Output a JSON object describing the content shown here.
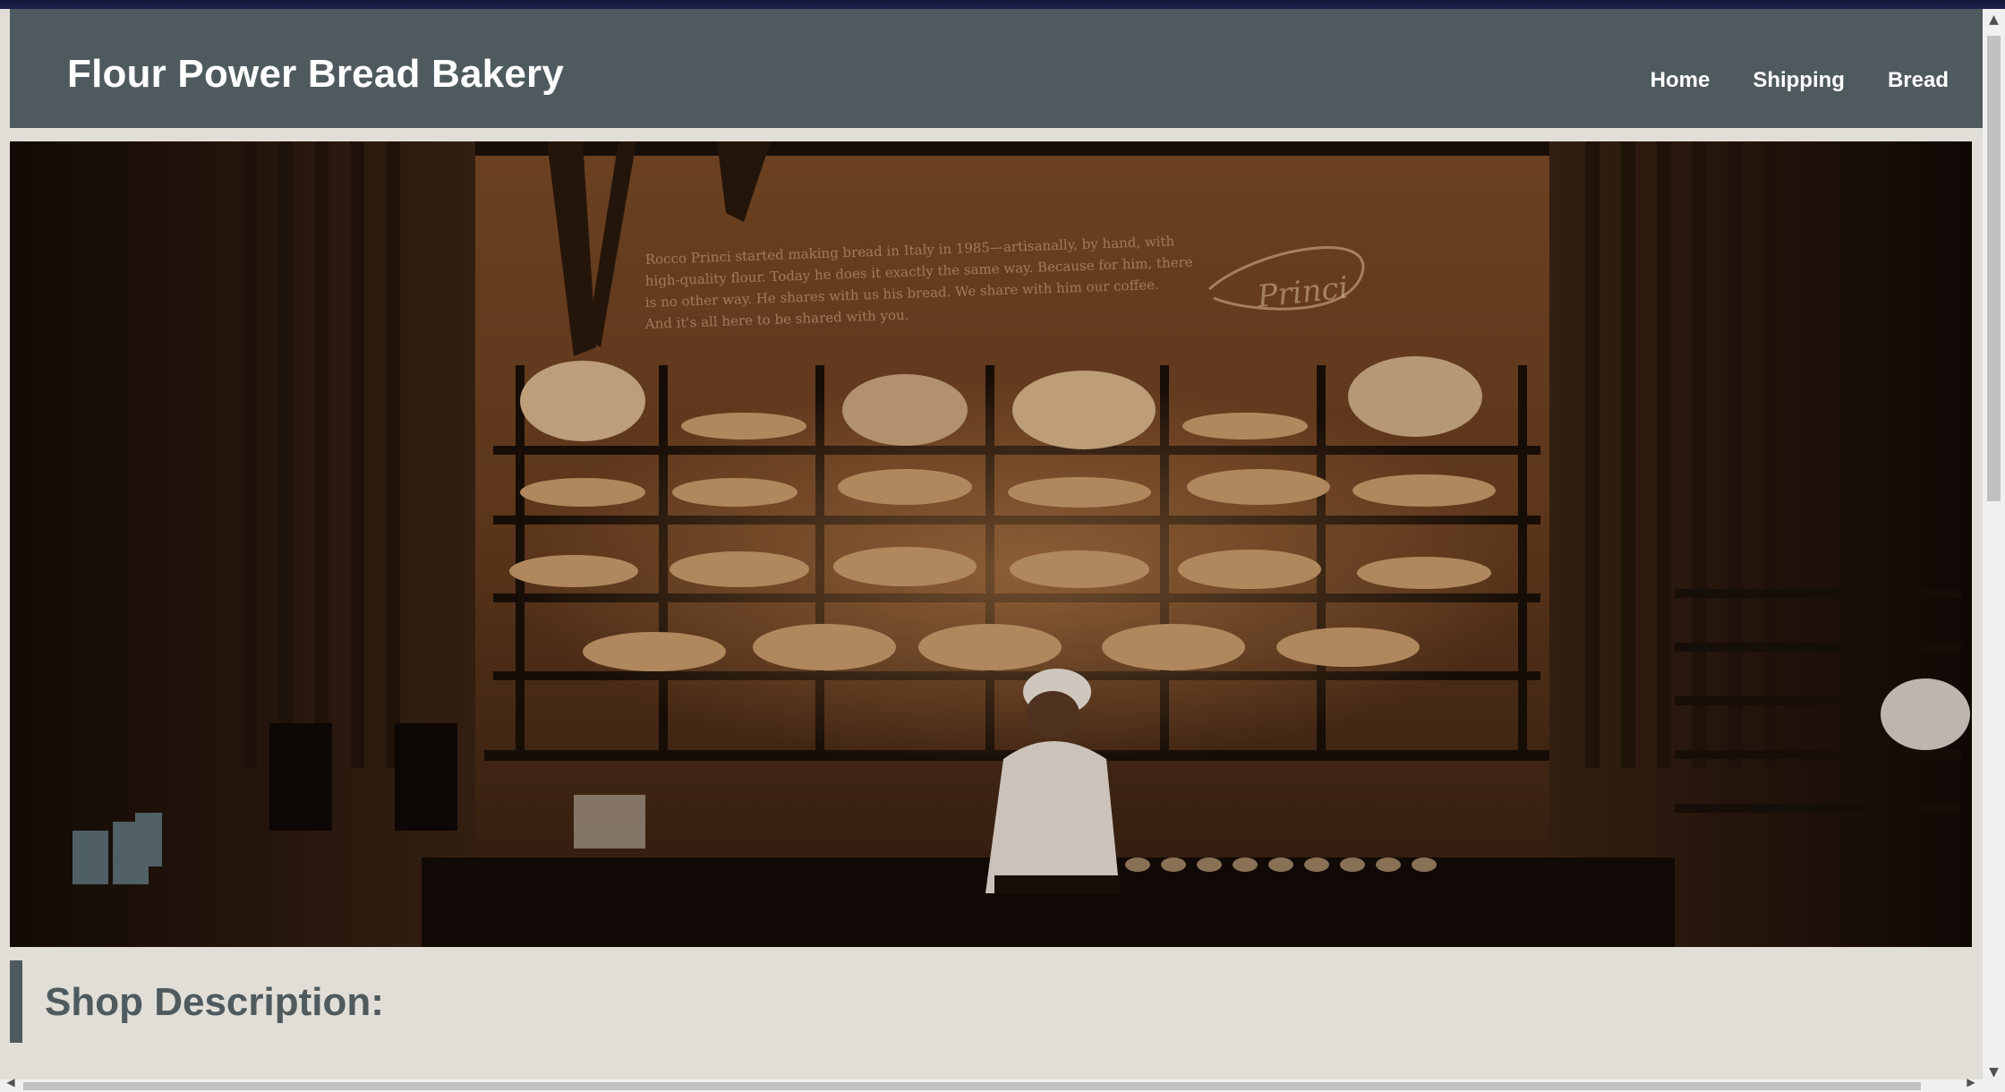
{
  "header": {
    "title": "Flour Power Bread Bakery",
    "nav": [
      {
        "label": "Home"
      },
      {
        "label": "Shipping"
      },
      {
        "label": "Bread"
      }
    ]
  },
  "hero": {
    "image": "bakery-shelves-photo",
    "wall_text": "Rocco Princi started making bread in Italy in 1985—artisanally, by hand, with high-quality flour. Today he does it exactly the same way. Because for him, there is no other way. He shares with us his bread. We share with him our coffee. And it's all here to be shared with you.",
    "wall_signature": "Princi"
  },
  "main": {
    "section_heading": "Shop Description:"
  },
  "scrollbars": {
    "up_icon": "arrow-up-icon",
    "down_icon": "arrow-down-icon",
    "left_icon": "arrow-left-icon",
    "right_icon": "arrow-right-icon"
  },
  "colors": {
    "header_bg": "#4f5a5e",
    "page_bg": "#e1ded8",
    "heading_text": "#4f5a5e"
  }
}
